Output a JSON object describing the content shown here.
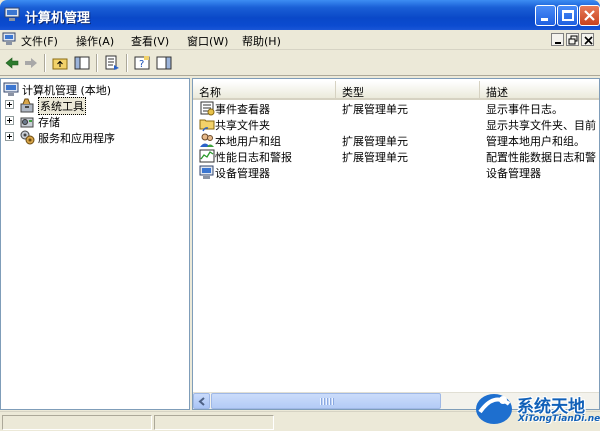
{
  "window": {
    "title": "计算机管理"
  },
  "menu": {
    "items": [
      {
        "label": "文件(F)"
      },
      {
        "label": "操作(A)"
      },
      {
        "label": "查看(V)"
      },
      {
        "label": "窗口(W)"
      },
      {
        "label": "帮助(H)"
      }
    ]
  },
  "tree": {
    "root": "计算机管理 (本地)",
    "children": [
      {
        "label": "系统工具",
        "icon": "tools-icon",
        "selected": true
      },
      {
        "label": "存储",
        "icon": "storage-icon"
      },
      {
        "label": "服务和应用程序",
        "icon": "services-icon"
      }
    ]
  },
  "list": {
    "columns": [
      "名称",
      "类型",
      "描述"
    ],
    "rows": [
      {
        "name": "事件查看器",
        "type": "扩展管理单元",
        "desc": "显示事件日志。",
        "icon": "event-viewer-icon"
      },
      {
        "name": "共享文件夹",
        "type": "",
        "desc": "显示共享文件夹、目前",
        "icon": "shared-folder-icon"
      },
      {
        "name": "本地用户和组",
        "type": "扩展管理单元",
        "desc": "管理本地用户和组。",
        "icon": "users-icon"
      },
      {
        "name": "性能日志和警报",
        "type": "扩展管理单元",
        "desc": "配置性能数据日志和警",
        "icon": "performance-icon"
      },
      {
        "name": "设备管理器",
        "type": "",
        "desc": "设备管理器",
        "icon": "device-manager-icon"
      }
    ]
  },
  "watermark": {
    "title": "系统天地",
    "sub": "XiTongTianDi.net"
  },
  "colors": {
    "titlebar": "#0a48c8",
    "pane_border": "#7f9db9",
    "window_bg": "#ece9d8"
  }
}
